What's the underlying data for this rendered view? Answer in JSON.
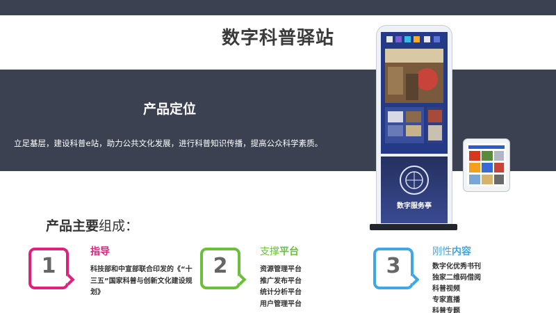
{
  "title": "数字科普驿站",
  "positioning": {
    "heading": "产品定位",
    "text": "立足基层，建设科普e站，助力公共文化发展，进行科普知识传播，提高公众科学素质。"
  },
  "components": {
    "heading_bold": "产品主要",
    "heading_rest": "组成：",
    "items": [
      {
        "number": "1",
        "title": "指导",
        "color": "#e0217b",
        "lines": [
          "科技部和中宣部联合印发的《“十",
          "三五”国家科普与创新文化建设规",
          "划》"
        ]
      },
      {
        "number": "2",
        "title_a": "支撑",
        "title_b": "平台",
        "color": "#6cbf3a",
        "lines": [
          "资源管理平台",
          "推广发布平台",
          "统计分析平台",
          "用户管理平台"
        ]
      },
      {
        "number": "3",
        "title_a": "刚性",
        "title_b": "内容",
        "color": "#3fa7e6",
        "lines": [
          "数字化优秀书刊",
          "独家二维码借阅",
          "科普视频",
          "专家直播",
          "科普专题"
        ]
      }
    ]
  },
  "kiosk": {
    "brand": "数字服务亭"
  }
}
